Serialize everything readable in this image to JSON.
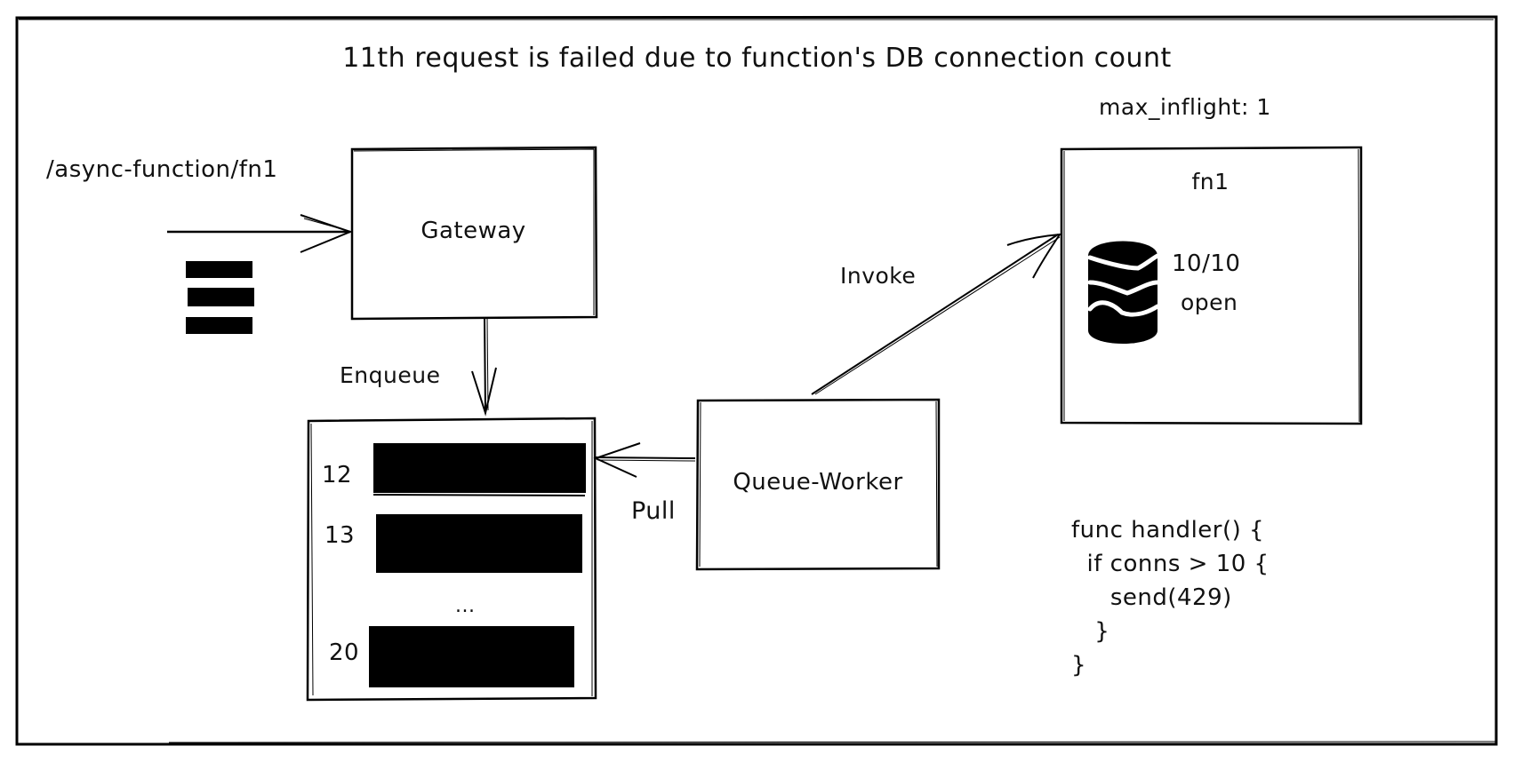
{
  "title": "11th request is failed due to function's DB connection count",
  "request": {
    "route": "/async-function/fn1",
    "pending_requests": 3
  },
  "gateway": {
    "label": "Gateway"
  },
  "queue": {
    "items": [
      {
        "id": "12"
      },
      {
        "id": "13"
      },
      {
        "id": "20"
      }
    ],
    "ellipsis": "..."
  },
  "queue_worker": {
    "label": "Queue-Worker"
  },
  "function": {
    "name": "fn1",
    "config_label": "max_inflight: 1",
    "db_connections": "10/10",
    "db_state": "open",
    "db_icon": "database-icon"
  },
  "edges": {
    "enqueue": "Enqueue",
    "invoke": "Invoke",
    "pull": "Pull"
  },
  "code": {
    "lines": [
      "func handler() {",
      "  if conns > 10 {",
      "     send(429)",
      "   }",
      "}"
    ]
  },
  "colors": {
    "ink": "#000000",
    "background": "#ffffff"
  }
}
